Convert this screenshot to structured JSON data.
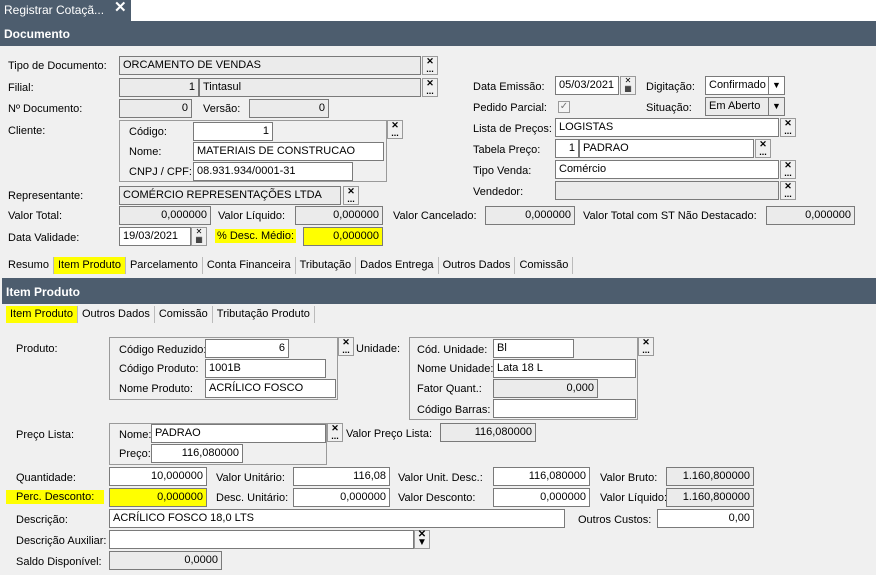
{
  "window": {
    "tab_title": "Registrar Cotaçã...",
    "close_glyph": "✕"
  },
  "documento": {
    "section_title": "Documento",
    "tipo_documento": {
      "label": "Tipo de Documento:",
      "value": "ORCAMENTO DE VENDAS"
    },
    "filial": {
      "label": "Filial:",
      "code": "1",
      "name": "Tintasul"
    },
    "n_documento": {
      "label": "Nº Documento:",
      "value": "0"
    },
    "versao": {
      "label": "Versão:",
      "value": "0"
    },
    "cliente": {
      "label": "Cliente:",
      "codigo_label": "Código:",
      "codigo": "1",
      "nome_label": "Nome:",
      "nome": "MATERIAIS DE CONSTRUCAO",
      "cnpj_label": "CNPJ / CPF:",
      "cnpj": "08.931.934/0001-31"
    },
    "representante": {
      "label": "Representante:",
      "value": "COMÉRCIO REPRESENTAÇÕES LTDA"
    },
    "data_emissao": {
      "label": "Data Emissão:",
      "value": "05/03/2021"
    },
    "digitacao": {
      "label": "Digitação:",
      "value": "Confirmado"
    },
    "pedido_parcial": {
      "label": "Pedido Parcial:",
      "checked": "✓"
    },
    "situacao": {
      "label": "Situação:",
      "value": "Em Aberto"
    },
    "lista_precos": {
      "label": "Lista de Preços:",
      "value": "LOGISTAS"
    },
    "tabela_preco": {
      "label": "Tabela Preço:",
      "code": "1",
      "name": "PADRAO"
    },
    "tipo_venda": {
      "label": "Tipo Venda:",
      "value": "Comércio"
    },
    "vendedor": {
      "label": "Vendedor:",
      "value": ""
    },
    "valor_total": {
      "label": "Valor Total:",
      "value": "0,000000"
    },
    "valor_liquido": {
      "label": "Valor Líquido:",
      "value": "0,000000"
    },
    "valor_cancelado": {
      "label": "Valor Cancelado:",
      "value": "0,000000"
    },
    "valor_total_st": {
      "label": "Valor Total com ST Não Destacado:",
      "value": "0,000000"
    },
    "data_validade": {
      "label": "Data Validade:",
      "value": "19/03/2021"
    },
    "desc_medio": {
      "label": "% Desc. Médio:",
      "value": "0,000000"
    }
  },
  "main_tabs": [
    "Resumo",
    "Item Produto",
    "Parcelamento",
    "Conta Financeira",
    "Tributação",
    "Dados Entrega",
    "Outros Dados",
    "Comissão"
  ],
  "main_tab_active": 1,
  "item": {
    "section_title": "Item Produto",
    "sub_tabs": [
      "Item Produto",
      "Outros Dados",
      "Comissão",
      "Tributação Produto"
    ],
    "produto": {
      "label": "Produto:",
      "codigo_reduzido_label": "Código Reduzido:",
      "codigo_reduzido": "6",
      "codigo_produto_label": "Código Produto:",
      "codigo_produto": "1001B",
      "nome_produto_label": "Nome Produto:",
      "nome_produto": "ACRÍLICO FOSCO"
    },
    "unidade": {
      "label": "Unidade:",
      "cod_unidade_label": "Cód. Unidade:",
      "cod_unidade": "Bl",
      "nome_unidade_label": "Nome Unidade:",
      "nome_unidade": "Lata 18 L",
      "fator_label": "Fator Quant.:",
      "fator": "0,000",
      "codigo_barras_label": "Código Barras:",
      "codigo_barras": ""
    },
    "preco_lista": {
      "label": "Preço Lista:",
      "nome_label": "Nome:",
      "nome": "PADRAO",
      "preco_label": "Preço:",
      "preco": "116,080000",
      "valor_label": "Valor Preço Lista:",
      "valor": "116,080000"
    },
    "quantidade": {
      "label": "Quantidade:",
      "value": "10,000000"
    },
    "valor_unitario": {
      "label": "Valor Unitário:",
      "value": "116,08"
    },
    "valor_unit_desc": {
      "label": "Valor Unit. Desc.:",
      "value": "116,080000"
    },
    "valor_bruto": {
      "label": "Valor Bruto:",
      "value": "1.160,800000"
    },
    "perc_desconto": {
      "label": "Perc. Desconto:",
      "value": "0,000000"
    },
    "desc_unitario": {
      "label": "Desc. Unitário:",
      "value": "0,000000"
    },
    "valor_desconto": {
      "label": "Valor Desconto:",
      "value": "0,000000"
    },
    "valor_liquido": {
      "label": "Valor Líquido:",
      "value": "1.160,800000"
    },
    "descricao": {
      "label": "Descrição:",
      "value": "ACRÍLICO FOSCO 18,0 LTS"
    },
    "outros_custos": {
      "label": "Outros Custos:",
      "value": "0,00"
    },
    "descricao_auxiliar": {
      "label": "Descrição Auxiliar:",
      "value": ""
    },
    "saldo_disponivel": {
      "label": "Saldo Disponível:",
      "value": "0,0000"
    }
  },
  "glyphs": {
    "lookup_top": "✕",
    "lookup_bottom": "...",
    "dropdown": "▼"
  },
  "colors": {
    "header": "#4d5d6e",
    "highlight": "#ffff00"
  }
}
